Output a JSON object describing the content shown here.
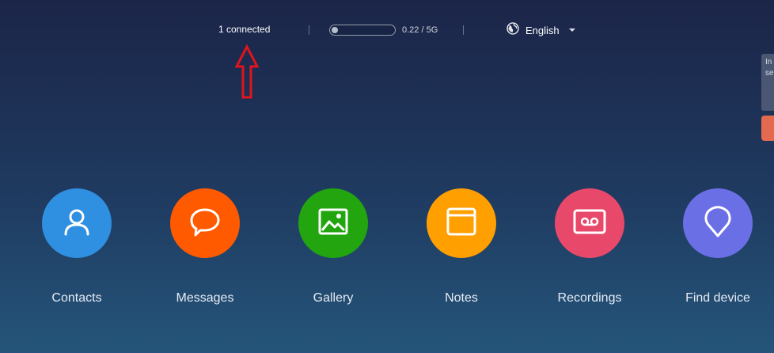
{
  "topbar": {
    "connection_status": "1 connected",
    "storage_text": "0.22 / 5G",
    "storage_used_fraction": 0.044,
    "language": "English"
  },
  "side_panel": {
    "tip_text": "In\nse"
  },
  "apps": [
    {
      "label": "Contacts",
      "icon": "contact-icon",
      "color": "#2f8fe0"
    },
    {
      "label": "Messages",
      "icon": "message-icon",
      "color": "#ff5a00"
    },
    {
      "label": "Gallery",
      "icon": "gallery-icon",
      "color": "#22a50f"
    },
    {
      "label": "Notes",
      "icon": "notes-icon",
      "color": "#ff9f00"
    },
    {
      "label": "Recordings",
      "icon": "recording-icon",
      "color": "#e8496b"
    },
    {
      "label": "Find device",
      "icon": "location-icon",
      "color": "#6b6fe6"
    }
  ],
  "colors": {
    "annotation_arrow": "#e0141e"
  }
}
